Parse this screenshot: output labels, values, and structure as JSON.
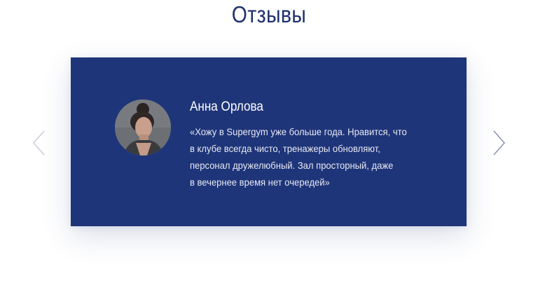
{
  "section": {
    "title": "Отзывы"
  },
  "navigation": {
    "prev_icon": "chevron-left-icon",
    "next_icon": "chevron-right-icon"
  },
  "review": {
    "author": "Анна Орлова",
    "avatar_icon": "user-photo",
    "text_lines": [
      "«Хожу в Supergym уже больше года. Нравится, что",
      "в клубе всегда чисто, тренажеры обновляют,",
      "персонал дружелюбный. Зал просторный, даже",
      "в вечернее время нет очередей»"
    ]
  },
  "colors": {
    "title": "#1e2f6e",
    "card_background": "#1f3579",
    "text": "#ffffff",
    "arrow_prev": "#c9cede",
    "arrow_next": "#8d96b5"
  }
}
